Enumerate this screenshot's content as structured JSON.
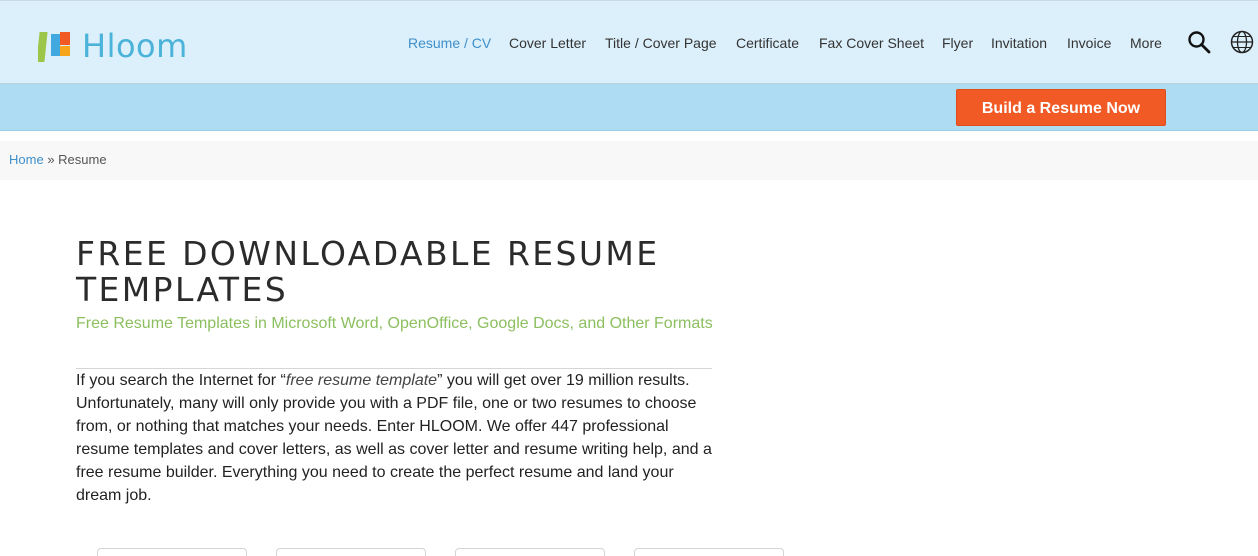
{
  "header": {
    "logo_text": "Hloom",
    "nav": [
      {
        "label": "Resume / CV",
        "active": true
      },
      {
        "label": "Cover Letter"
      },
      {
        "label": "Title / Cover Page"
      },
      {
        "label": "Certificate"
      },
      {
        "label": "Fax Cover Sheet"
      },
      {
        "label": "Flyer"
      },
      {
        "label": "Invitation"
      },
      {
        "label": "Invoice"
      },
      {
        "label": "More"
      }
    ],
    "icons": [
      "search-icon",
      "globe-icon"
    ]
  },
  "cta": {
    "label": "Build a Resume Now",
    "color": "#f15a24"
  },
  "breadcrumb": {
    "home": "Home",
    "separator": "»",
    "current": "Resume"
  },
  "main": {
    "title": "FREE DOWNLOADABLE RESUME TEMPLATES",
    "subtitle": "Free Resume Templates in Microsoft Word, OpenOffice, Google Docs, and Other Formats",
    "body_pre": "If you search the Internet for “",
    "body_em": "free resume template",
    "body_post": "” you will get over 19 million results. Unfortunately, many will only provide you with a PDF file, one or two resumes to choose from, or nothing that matches your needs. Enter HLOOM. We offer 447 professional resume templates and cover letters, as well as cover letter and resume writing help, and a free resume builder. Everything you need to create the perfect resume and land your dream job."
  },
  "colors": {
    "header_bg": "#dcf0fb",
    "subbar_bg": "#aedcf3",
    "accent_blue": "#3f8fcb",
    "subtitle_green": "#8cbf5f"
  }
}
